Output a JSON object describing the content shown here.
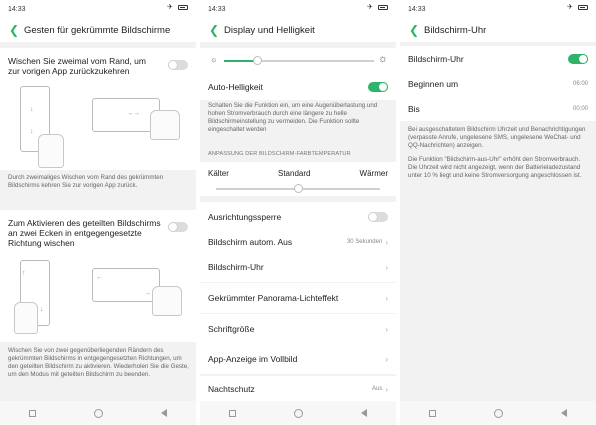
{
  "status": {
    "time": "14:33",
    "signal_icon": "signal-icon",
    "battery_icon": "battery-icon"
  },
  "nav": {
    "recent": "recent-apps-icon",
    "home": "home-icon",
    "back": "back-nav-icon"
  },
  "panel1": {
    "title": "Gesten für gekrümmte Bildschirme",
    "gesture1_label": "Wischen Sie zweimal vom Rand, um zur vorigen App zurückzukehren",
    "gesture1_desc": "Durch zweimaliges Wischen vom Rand des gekrümmten Bildschirms kehren Sie zur vorigen App zurück.",
    "gesture2_label": "Zum Aktivieren des geteilten Bildschirms an zwei Ecken in entgegengesetzte Richtung wischen",
    "gesture2_desc": "Wischen Sie von zwei gegenüberliegenden Rändern des gekrümmten Bildschirms in entgegengesetzten Richtungen, um den geteilten Bildschirm zu aktivieren. Wiederholen Sie die Geste, um den Modus mit geteilten Bildschirm zu beenden."
  },
  "panel2": {
    "title": "Display und Helligkeit",
    "brightness": 0.22,
    "auto_brightness_label": "Auto-Helligkeit",
    "auto_brightness_desc": "Schalten Sie die Funktion ein, um eine Augenüberlastung und hohen Stromverbrauch durch eine längere zu helle Bildschirmeinstellung zu vermeiden. Die Funktion sollte eingeschaltet werden",
    "color_temp_heading": "ANPASSUNG DER BILDSCHIRM-FARBTEMPERATUR",
    "color_temp_cold": "Kälter",
    "color_temp_standard": "Standard",
    "color_temp_warm": "Wärmer",
    "color_temp_value": 0.5,
    "items": [
      {
        "label": "Ausrichtungssperre",
        "value": ""
      },
      {
        "label": "Bildschirm autom. Aus",
        "value": "30 Sekunden"
      },
      {
        "label": "Bildschirm-Uhr",
        "value": ""
      },
      {
        "label": "Gekrümmter Panorama-Lichteffekt",
        "value": ""
      },
      {
        "label": "Schriftgröße",
        "value": ""
      },
      {
        "label": "App-Anzeige im Vollbild",
        "value": ""
      },
      {
        "label": "Nachtschutz",
        "value": "Aus"
      }
    ]
  },
  "panel3": {
    "title": "Bildschirm-Uhr",
    "clock_label": "Bildschirm-Uhr",
    "start_label": "Beginnen um",
    "start_value": "06:00",
    "end_label": "Bis",
    "end_value": "00:00",
    "desc1": "Bei ausgeschaltetem Bildschirm Uhrzeit und Benachrichtigungen (verpasste Anrufe, ungelesene SMS, ungelesene WeChat- und QQ-Nachrichten) anzeigen.",
    "desc2": "Die Funktion \"Bildschirm-aus-Uhr\" erhöht den Stromverbrauch. Die Uhrzeit wird nicht angezeigt, wenn der Batterieladezustand unter 10 % liegt und keine Stromversorgung angeschlossen ist."
  }
}
